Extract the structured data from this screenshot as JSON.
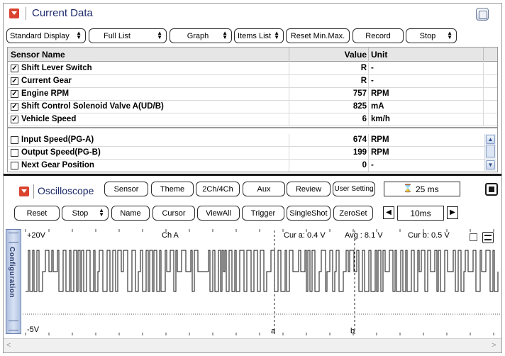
{
  "current_data": {
    "title": "Current Data",
    "toolbar": {
      "standard_display": "Standard Display",
      "full_list": "Full List",
      "graph": "Graph",
      "items_list": "Items List",
      "reset_minmax": "Reset Min.Max.",
      "record": "Record",
      "stop": "Stop"
    },
    "table": {
      "headers": {
        "name": "Sensor Name",
        "value": "Value",
        "unit": "Unit"
      },
      "rows": [
        {
          "checked": true,
          "name": "Shift Lever Switch",
          "value": "R",
          "unit": "-"
        },
        {
          "checked": true,
          "name": "Current Gear",
          "value": "R",
          "unit": "-"
        },
        {
          "checked": true,
          "name": "Engine RPM",
          "value": "757",
          "unit": "RPM"
        },
        {
          "checked": true,
          "name": "Shift Control Solenoid Valve A(UD/B)",
          "value": "825",
          "unit": "mA"
        },
        {
          "checked": true,
          "name": "Vehicle Speed",
          "value": "6",
          "unit": "km/h"
        },
        {
          "checked": false,
          "name": "Input Speed(PG-A)",
          "value": "674",
          "unit": "RPM"
        },
        {
          "checked": false,
          "name": "Output Speed(PG-B)",
          "value": "199",
          "unit": "RPM"
        },
        {
          "checked": false,
          "name": "Next Gear Position",
          "value": "0",
          "unit": "-"
        }
      ]
    }
  },
  "oscilloscope": {
    "title": "Oscilloscope",
    "row1": {
      "sensor": "Sensor",
      "theme": "Theme",
      "channels": "2Ch/4Ch",
      "aux": "Aux",
      "review": "Review",
      "user_setting": "User Setting",
      "time": "25 ms"
    },
    "row2": {
      "reset": "Reset",
      "stop": "Stop",
      "name": "Name",
      "cursor": "Cursor",
      "view_all": "ViewAll",
      "trigger": "Trigger",
      "single_shot": "SingleShot",
      "zero_set": "ZeroSet",
      "timebase": "10ms"
    },
    "config_tab": "Configuration",
    "scope": {
      "top_label": "+20V",
      "bottom_label": "-5V",
      "channel": "Ch A",
      "cur_a": "Cur a: 0.4 V",
      "avg": "Avg : 8.1 V",
      "cur_b": "Cur b: 0.5 V",
      "marker_a": "a",
      "marker_b": "b"
    }
  }
}
